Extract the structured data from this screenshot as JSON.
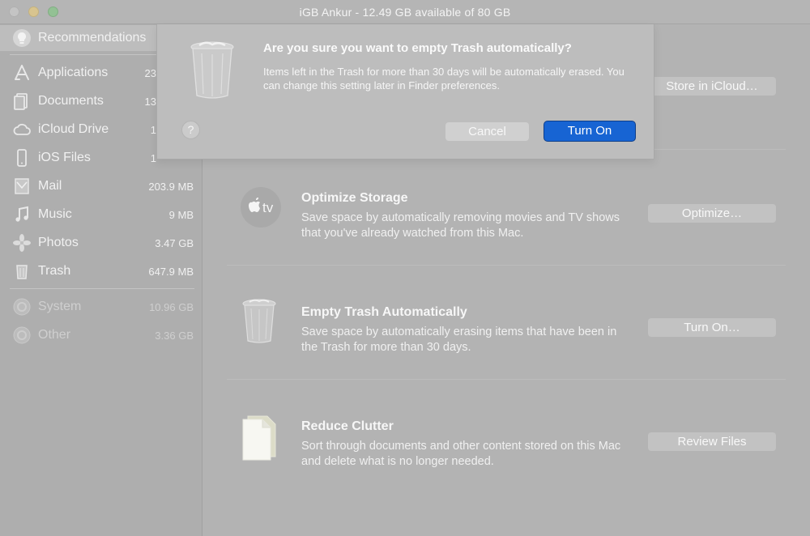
{
  "window": {
    "title": "iGB Ankur - 12.49 GB available of 80 GB"
  },
  "sidebar": {
    "items": [
      {
        "label": "Recommendations",
        "size": "",
        "icon": "lightbulb-icon"
      },
      {
        "label": "Applications",
        "size": "23",
        "icon": "app-store-icon"
      },
      {
        "label": "Documents",
        "size": "13",
        "icon": "documents-icon"
      },
      {
        "label": "iCloud Drive",
        "size": "1",
        "icon": "cloud-icon"
      },
      {
        "label": "iOS Files",
        "size": "1",
        "icon": "iphone-icon"
      },
      {
        "label": "Mail",
        "size": "203.9 MB",
        "icon": "mail-icon"
      },
      {
        "label": "Music",
        "size": "9 MB",
        "icon": "music-note-icon"
      },
      {
        "label": "Photos",
        "size": "3.47 GB",
        "icon": "photos-icon"
      },
      {
        "label": "Trash",
        "size": "647.9 MB",
        "icon": "trash-icon"
      },
      {
        "label": "System",
        "size": "10.96 GB",
        "icon": "gear-icon"
      },
      {
        "label": "Other",
        "size": "3.36 GB",
        "icon": "gear-icon"
      }
    ]
  },
  "main": {
    "rows": [
      {
        "title": "",
        "description": "",
        "button": "Store in iCloud…"
      },
      {
        "title": "Optimize Storage",
        "description": "Save space by automatically removing movies and TV shows that you've already watched from this Mac.",
        "button": "Optimize…",
        "icon_text": "tv"
      },
      {
        "title": "Empty Trash Automatically",
        "description": "Save space by automatically erasing items that have been in the Trash for more than 30 days.",
        "button": "Turn On…"
      },
      {
        "title": "Reduce Clutter",
        "description": "Sort through documents and other content stored on this Mac and delete what is no longer needed.",
        "button": "Review Files"
      }
    ]
  },
  "dialog": {
    "title": "Are you sure you want to empty Trash automatically?",
    "message": "Items left in the Trash for more than 30 days will be automatically erased. You can change this setting later in Finder preferences.",
    "help": "?",
    "cancel": "Cancel",
    "confirm": "Turn On"
  },
  "colors": {
    "accent": "#1764d3",
    "overlay": "#b3b3b3"
  }
}
